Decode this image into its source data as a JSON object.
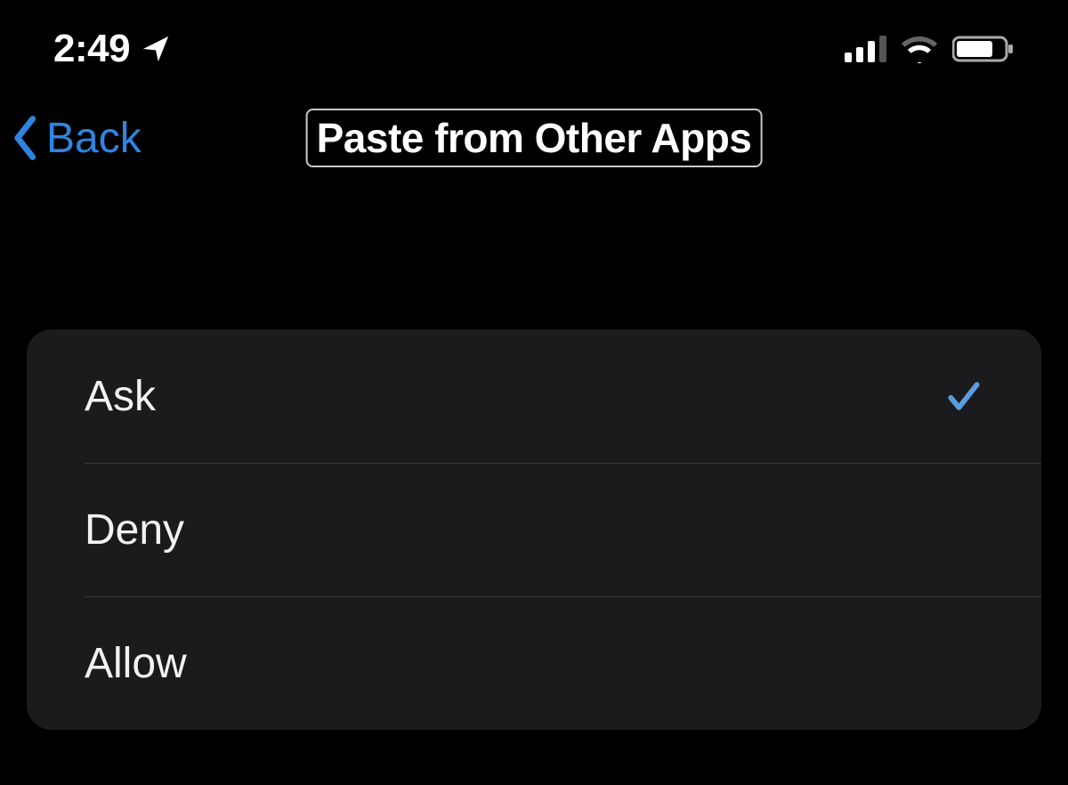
{
  "status_bar": {
    "time": "2:49",
    "icons": {
      "location": "location-arrow-icon",
      "cellular": "cellular-signal-icon",
      "cellular_bars_active": 3,
      "wifi": "wifi-icon",
      "battery": "battery-icon"
    }
  },
  "nav": {
    "back_label": "Back",
    "title": "Paste from Other Apps"
  },
  "options": [
    {
      "label": "Ask",
      "selected": true
    },
    {
      "label": "Deny",
      "selected": false
    },
    {
      "label": "Allow",
      "selected": false
    }
  ],
  "colors": {
    "accent": "#2f84e0",
    "background": "#000000",
    "group_bg": "#1b1b1d",
    "separator": "#3a3a3c"
  }
}
